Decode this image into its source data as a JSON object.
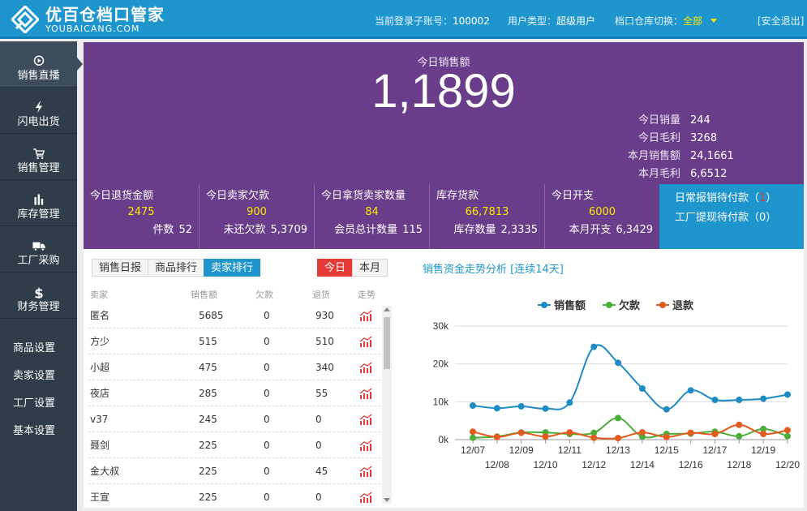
{
  "header": {
    "brand_cn": "优百仓档口管家",
    "brand_en": "YOUBAICANG.COM",
    "account_label": "当前登录子账号：",
    "account_value": "100002",
    "user_type_label": "用户类型：",
    "user_type_value": "超级用户",
    "warehouse_label": "档口仓库切换：",
    "warehouse_value": "全部",
    "logout": "[安全退出]"
  },
  "sidebar": {
    "items": [
      {
        "label": "销售直播",
        "icon": "play-circle-icon"
      },
      {
        "label": "闪电出货",
        "icon": "lightning-icon"
      },
      {
        "label": "销售管理",
        "icon": "cart-icon"
      },
      {
        "label": "库存管理",
        "icon": "bar-chart-icon"
      },
      {
        "label": "工厂采购",
        "icon": "truck-icon"
      },
      {
        "label": "财务管理",
        "icon": "dollar-icon"
      }
    ],
    "settings": [
      "商品设置",
      "卖家设置",
      "工厂设置",
      "基本设置"
    ]
  },
  "summary": {
    "today_sales_label": "今日销售额",
    "today_sales_value": "1,1899",
    "stats": [
      {
        "label": "今日销量",
        "value": "244"
      },
      {
        "label": "今日毛利",
        "value": "3268"
      },
      {
        "label": "本月销售额",
        "value": "24,1661"
      },
      {
        "label": "本月毛利",
        "value": "6,6512"
      }
    ]
  },
  "tiles": [
    {
      "title": "今日退货金额",
      "main": "2475",
      "sub_label": "件数",
      "sub_value": "52"
    },
    {
      "title": "今日卖家欠款",
      "main": "900",
      "sub_label": "未还欠款",
      "sub_value": "5,3709"
    },
    {
      "title": "今日拿货卖家数量",
      "main": "84",
      "sub_label": "会员总计数量",
      "sub_value": "115"
    },
    {
      "title": "库存货款",
      "main": "66,7813",
      "sub_label": "库存数量",
      "sub_value": "2,3335"
    },
    {
      "title": "今日开支",
      "main": "6000",
      "sub_label": "本月开支",
      "sub_value": "6,3429"
    }
  ],
  "payments": {
    "daily_label": "日常报销待付款（",
    "daily_value": "1",
    "factory_label": "工厂提现待付款（",
    "factory_value": "0",
    "close": "）"
  },
  "table_panel": {
    "tabs": [
      "销售日报",
      "商品排行",
      "卖家排行"
    ],
    "active_tab": 2,
    "period": [
      "今日",
      "本月"
    ],
    "columns": [
      "卖家",
      "销售额",
      "欠款",
      "退货",
      "走势"
    ],
    "rows": [
      {
        "seller": "匿名",
        "sales": "5685",
        "debt": "0",
        "returns": "930"
      },
      {
        "seller": "方少",
        "sales": "515",
        "debt": "0",
        "returns": "510"
      },
      {
        "seller": "小超",
        "sales": "475",
        "debt": "0",
        "returns": "340"
      },
      {
        "seller": "夜店",
        "sales": "285",
        "debt": "0",
        "returns": "55"
      },
      {
        "seller": "v37",
        "sales": "245",
        "debt": "0",
        "returns": "0"
      },
      {
        "seller": "聂剑",
        "sales": "225",
        "debt": "0",
        "returns": "0"
      },
      {
        "seller": "金大叔",
        "sales": "225",
        "debt": "0",
        "returns": "45"
      },
      {
        "seller": "王宣",
        "sales": "225",
        "debt": "0",
        "returns": "0"
      }
    ]
  },
  "chart_title": "销售资金走势分析 [连续14天]",
  "colors": {
    "sales": "#1e8bc3",
    "debt": "#4cae3a",
    "returns": "#e25a1c"
  },
  "chart_data": {
    "type": "line",
    "x": [
      "12/07",
      "12/08",
      "12/09",
      "12/10",
      "12/11",
      "12/12",
      "12/13",
      "12/14",
      "12/15",
      "12/16",
      "12/17",
      "12/18",
      "12/19",
      "12/20"
    ],
    "series": [
      {
        "name": "销售额",
        "values": [
          9000,
          8300,
          8800,
          8200,
          9800,
          24500,
          20300,
          13500,
          8000,
          13000,
          10500,
          10500,
          10800,
          11900
        ]
      },
      {
        "name": "欠款",
        "values": [
          500,
          800,
          1900,
          1900,
          1500,
          1800,
          5700,
          800,
          1500,
          1600,
          2100,
          900,
          2800,
          900
        ]
      },
      {
        "name": "退款",
        "values": [
          2100,
          700,
          1800,
          800,
          1900,
          500,
          400,
          1900,
          700,
          1800,
          1500,
          3900,
          1500,
          2500
        ]
      }
    ],
    "yticks": [
      "0k",
      "10k",
      "20k",
      "30k"
    ],
    "ylim": [
      0,
      30000
    ],
    "legend": "top-center",
    "grid": true
  }
}
